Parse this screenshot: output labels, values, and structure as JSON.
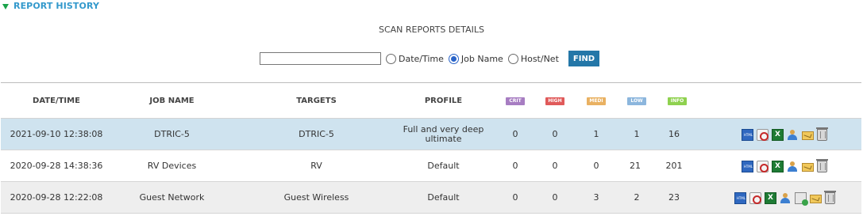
{
  "section": {
    "title": "REPORT HISTORY"
  },
  "subtitle": "SCAN REPORTS DETAILS",
  "search": {
    "value": "",
    "placeholder": "",
    "options": [
      {
        "label": "Date/Time",
        "checked": false
      },
      {
        "label": "Job Name",
        "checked": true
      },
      {
        "label": "Host/Net",
        "checked": false
      }
    ],
    "button": "FIND"
  },
  "columns": {
    "datetime": "DATE/TIME",
    "jobname": "JOB NAME",
    "targets": "TARGETS",
    "profile": "PROFILE",
    "crit": "CRIT",
    "high": "HIGH",
    "med": "MEDI",
    "low": "LOW",
    "info": "INFO"
  },
  "badge_colors": {
    "crit": "#a77dc2",
    "high": "#e05a5a",
    "med": "#e9b162",
    "low": "#8cb6dd",
    "info": "#8fd14f"
  },
  "rows": [
    {
      "datetime": "2021-09-10 12:38:08",
      "jobname": "DTRIC-5",
      "targets": "DTRIC-5",
      "profile": "Full and very deep ultimate",
      "crit": "0",
      "high": "0",
      "med": "1",
      "low": "1",
      "info": "16",
      "actions": [
        "html-icon",
        "pdf-icon",
        "excel-icon",
        "user-icon",
        "mail-icon",
        "trash-icon"
      ]
    },
    {
      "datetime": "2020-09-28 14:38:36",
      "jobname": "RV Devices",
      "targets": "RV",
      "profile": "Default",
      "crit": "0",
      "high": "0",
      "med": "0",
      "low": "21",
      "info": "201",
      "actions": [
        "html-icon",
        "pdf-icon",
        "excel-icon",
        "user-icon",
        "mail-icon",
        "trash-icon"
      ]
    },
    {
      "datetime": "2020-09-28 12:22:08",
      "jobname": "Guest Network",
      "targets": "Guest Wireless",
      "profile": "Default",
      "crit": "0",
      "high": "0",
      "med": "3",
      "low": "2",
      "info": "23",
      "actions": [
        "html-icon",
        "pdf-icon",
        "excel-icon",
        "user-icon",
        "document-icon",
        "mail-icon",
        "trash-icon"
      ]
    }
  ]
}
